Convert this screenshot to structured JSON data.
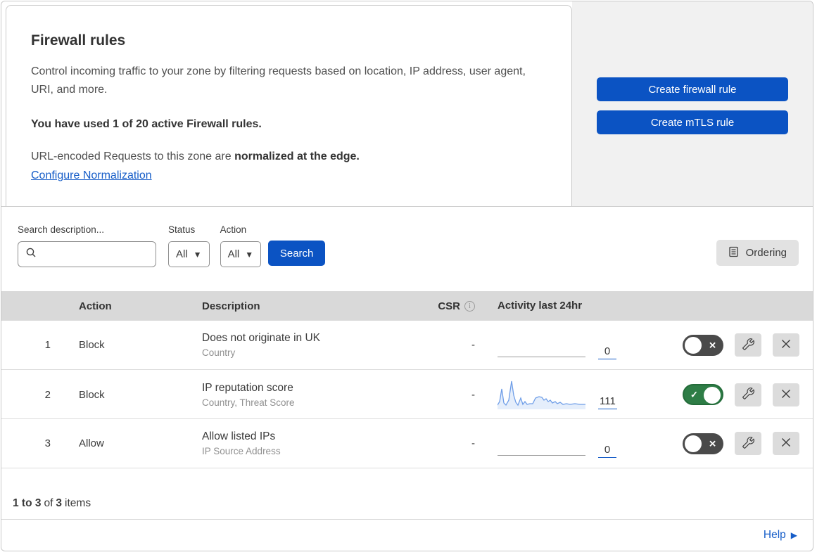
{
  "intro": {
    "title": "Firewall rules",
    "description": "Control incoming traffic to your zone by filtering requests based on location, IP address, user agent, URI, and more.",
    "usage_note": "You have used 1 of 20 active Firewall rules.",
    "normalization_prefix": "URL-encoded Requests to this zone are",
    "normalization_bold": "normalized at the edge.",
    "normalization_link": "Configure Normalization"
  },
  "actions_panel": {
    "create_firewall_rule": "Create firewall rule",
    "create_mtls_rule": "Create mTLS rule"
  },
  "filters": {
    "search_label": "Search description...",
    "status_label": "Status",
    "status_value": "All",
    "action_label": "Action",
    "action_value": "All",
    "search_button": "Search",
    "ordering_button": "Ordering"
  },
  "table": {
    "headers": {
      "action": "Action",
      "description": "Description",
      "csr": "CSR",
      "activity": "Activity last 24hr"
    },
    "rows": [
      {
        "priority": "1",
        "action": "Block",
        "description": "Does not originate in UK",
        "fields": "Country",
        "csr": "-",
        "activity_count": "0",
        "enabled": false
      },
      {
        "priority": "2",
        "action": "Block",
        "description": "IP reputation score",
        "fields": "Country, Threat Score",
        "csr": "-",
        "activity_count": "111",
        "enabled": true,
        "spark_line": "0,38 3,33 6,15 9,35 12,38 16,31 20,4 23,24 26,34 29,38 33,28 36,37 39,33 42,37 46,36 50,36 54,28 59,26 63,27 66,31 69,29 72,33 75,31 78,35 82,33 85,36 89,34 93,37 98,36 103,37 110,36 117,37 125,37",
        "spark_fill": "0,38 3,33 6,15 9,35 12,38 16,31 20,4 23,24 26,34 29,38 33,28 36,37 39,33 42,37 46,36 50,36 54,28 59,26 63,27 66,31 69,29 72,33 75,31 78,35 82,33 85,36 89,34 93,37 98,36 103,37 110,36 117,37 125,37 125,44 0,44"
      },
      {
        "priority": "3",
        "action": "Allow",
        "description": "Allow listed IPs",
        "fields": "IP Source Address",
        "csr": "-",
        "activity_count": "0",
        "enabled": false
      }
    ]
  },
  "footer": {
    "range": "1 to 3",
    "of": "of",
    "total": "3",
    "items_label": "items",
    "help_label": "Help"
  },
  "colors": {
    "accent_blue": "#0b53c3",
    "link_blue": "#165dc8",
    "toggle_on_green": "#2e7d46",
    "toggle_off_gray": "#4a4a4a",
    "sparkline_blue": "#6f9ee8",
    "table_header_bg": "#d9d9d9",
    "panel_bg": "#f1f1f1"
  }
}
